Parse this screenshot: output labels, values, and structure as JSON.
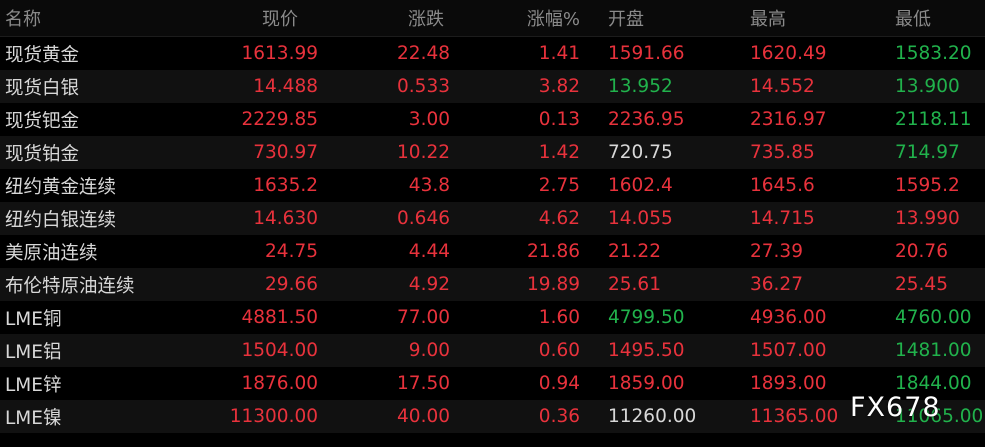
{
  "colors": {
    "up": "#e8323c",
    "down": "#21b24c",
    "neutral": "#d8d8d8"
  },
  "header": {
    "name": "名称",
    "price": "现价",
    "change": "涨跌",
    "change_pct": "涨幅%",
    "open": "开盘",
    "high": "最高",
    "low": "最低"
  },
  "rows": [
    {
      "name": "现货黄金",
      "price": "1613.99",
      "change": "22.48",
      "change_pct": "1.41",
      "open": "1591.66",
      "high": "1620.49",
      "low": "1583.20",
      "price_color": "up",
      "change_color": "up",
      "change_pct_color": "up",
      "open_color": "up",
      "high_color": "up",
      "low_color": "down"
    },
    {
      "name": "现货白银",
      "price": "14.488",
      "change": "0.533",
      "change_pct": "3.82",
      "open": "13.952",
      "high": "14.552",
      "low": "13.900",
      "price_color": "up",
      "change_color": "up",
      "change_pct_color": "up",
      "open_color": "down",
      "high_color": "up",
      "low_color": "down"
    },
    {
      "name": "现货钯金",
      "price": "2229.85",
      "change": "3.00",
      "change_pct": "0.13",
      "open": "2236.95",
      "high": "2316.97",
      "low": "2118.11",
      "price_color": "up",
      "change_color": "up",
      "change_pct_color": "up",
      "open_color": "up",
      "high_color": "up",
      "low_color": "down"
    },
    {
      "name": "现货铂金",
      "price": "730.97",
      "change": "10.22",
      "change_pct": "1.42",
      "open": "720.75",
      "high": "735.85",
      "low": "714.97",
      "price_color": "up",
      "change_color": "up",
      "change_pct_color": "up",
      "open_color": "neutral",
      "high_color": "up",
      "low_color": "down"
    },
    {
      "name": "纽约黄金连续",
      "price": "1635.2",
      "change": "43.8",
      "change_pct": "2.75",
      "open": "1602.4",
      "high": "1645.6",
      "low": "1595.2",
      "price_color": "up",
      "change_color": "up",
      "change_pct_color": "up",
      "open_color": "up",
      "high_color": "up",
      "low_color": "up"
    },
    {
      "name": "纽约白银连续",
      "price": "14.630",
      "change": "0.646",
      "change_pct": "4.62",
      "open": "14.055",
      "high": "14.715",
      "low": "13.990",
      "price_color": "up",
      "change_color": "up",
      "change_pct_color": "up",
      "open_color": "up",
      "high_color": "up",
      "low_color": "up"
    },
    {
      "name": "美原油连续",
      "price": "24.75",
      "change": "4.44",
      "change_pct": "21.86",
      "open": "21.22",
      "high": "27.39",
      "low": "20.76",
      "price_color": "up",
      "change_color": "up",
      "change_pct_color": "up",
      "open_color": "up",
      "high_color": "up",
      "low_color": "up"
    },
    {
      "name": "布伦特原油连续",
      "price": "29.66",
      "change": "4.92",
      "change_pct": "19.89",
      "open": "25.61",
      "high": "36.27",
      "low": "25.45",
      "price_color": "up",
      "change_color": "up",
      "change_pct_color": "up",
      "open_color": "up",
      "high_color": "up",
      "low_color": "up"
    },
    {
      "name": "LME铜",
      "price": "4881.50",
      "change": "77.00",
      "change_pct": "1.60",
      "open": "4799.50",
      "high": "4936.00",
      "low": "4760.00",
      "price_color": "up",
      "change_color": "up",
      "change_pct_color": "up",
      "open_color": "down",
      "high_color": "up",
      "low_color": "down"
    },
    {
      "name": "LME铝",
      "price": "1504.00",
      "change": "9.00",
      "change_pct": "0.60",
      "open": "1495.50",
      "high": "1507.00",
      "low": "1481.00",
      "price_color": "up",
      "change_color": "up",
      "change_pct_color": "up",
      "open_color": "up",
      "high_color": "up",
      "low_color": "down"
    },
    {
      "name": "LME锌",
      "price": "1876.00",
      "change": "17.50",
      "change_pct": "0.94",
      "open": "1859.00",
      "high": "1893.00",
      "low": "1844.00",
      "price_color": "up",
      "change_color": "up",
      "change_pct_color": "up",
      "open_color": "up",
      "high_color": "up",
      "low_color": "down"
    },
    {
      "name": "LME镍",
      "price": "11300.00",
      "change": "40.00",
      "change_pct": "0.36",
      "open": "11260.00",
      "high": "11365.00",
      "low": "11065.00",
      "price_color": "up",
      "change_color": "up",
      "change_pct_color": "up",
      "open_color": "neutral",
      "high_color": "up",
      "low_color": "down"
    }
  ],
  "watermark": "FX678"
}
